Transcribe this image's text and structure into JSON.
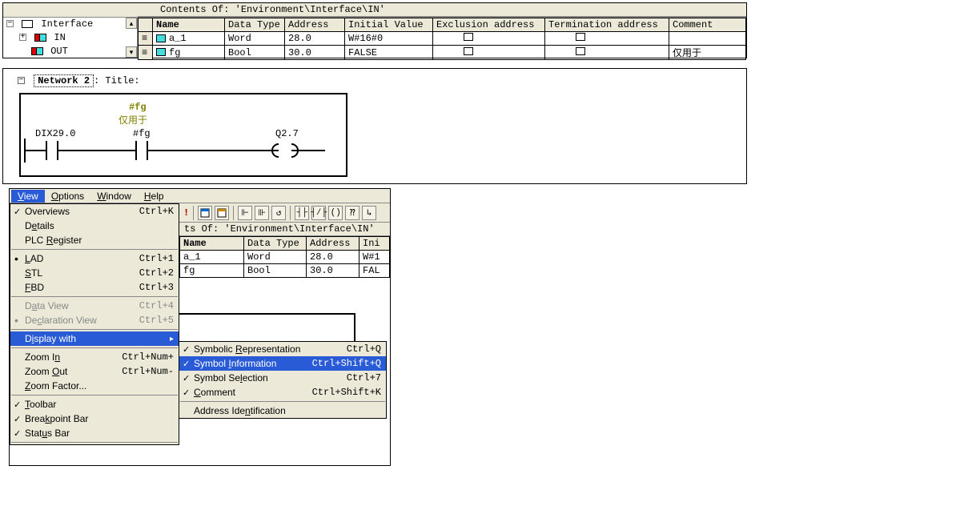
{
  "top": {
    "title": "Contents Of: 'Environment\\Interface\\IN'",
    "tree": {
      "root": "Interface",
      "child1": "IN",
      "child2": "OUT"
    },
    "columns": {
      "name": "Name",
      "dtype": "Data Type",
      "addr": "Address",
      "init": "Initial Value",
      "excl": "Exclusion address",
      "term": "Termination address",
      "comment": "Comment"
    },
    "rows": [
      {
        "name": "a_1",
        "dtype": "Word",
        "addr": "28.0",
        "init": "W#16#0",
        "comment": ""
      },
      {
        "name": "fg",
        "dtype": "Bool",
        "addr": "30.0",
        "init": "FALSE",
        "comment": "仅用于"
      }
    ]
  },
  "network": {
    "label": "Network 2",
    "suffix": ": Title:",
    "tag_top": "#fg",
    "tag_sub": "仅用于",
    "left": "DIX29.0",
    "mid": "#fg",
    "right": "Q2.7"
  },
  "menubar": {
    "view": "View",
    "options": "Options",
    "window": "Window",
    "help": "Help"
  },
  "toolbar": {
    "excl": "!",
    "sym1": "⎕",
    "sym2": "⎕",
    "cont1": "⊩",
    "cont2": "⊪",
    "cont3": "↺",
    "lad1": "┤├",
    "lad2": "┤⁄├",
    "coil": "─()",
    "box": "⁇",
    "tail": "↳"
  },
  "sec": {
    "title": "ts Of: 'Environment\\Interface\\IN'",
    "columns": {
      "name": "Name",
      "dtype": "Data Type",
      "addr": "Address",
      "init": "Ini"
    },
    "rows": [
      {
        "name": "a_1",
        "dtype": "Word",
        "addr": "28.0",
        "init": "W#1"
      },
      {
        "name": "fg",
        "dtype": "Bool",
        "addr": "30.0",
        "init": "FAL"
      }
    ]
  },
  "viewmenu": {
    "overviews": {
      "label": "Overviews",
      "scut": "Ctrl+K"
    },
    "details": {
      "label": "Details"
    },
    "plcreg": {
      "label": "PLC Register"
    },
    "lad": {
      "label": "LAD",
      "scut": "Ctrl+1"
    },
    "stl": {
      "label": "STL",
      "scut": "Ctrl+2"
    },
    "fbd": {
      "label": "FBD",
      "scut": "Ctrl+3"
    },
    "dataview": {
      "label": "Data View",
      "scut": "Ctrl+4"
    },
    "declview": {
      "label": "Declaration View",
      "scut": "Ctrl+5"
    },
    "display": {
      "label": "Display with"
    },
    "zoomin": {
      "label": "Zoom In",
      "scut": "Ctrl+Num+"
    },
    "zoomout": {
      "label": "Zoom Out",
      "scut": "Ctrl+Num-"
    },
    "zoomfact": {
      "label": "Zoom Factor..."
    },
    "toolbar": {
      "label": "Toolbar"
    },
    "bpbar": {
      "label": "Breakpoint Bar"
    },
    "statusbar": {
      "label": "Status Bar"
    }
  },
  "submenu": {
    "symrep": {
      "label": "Symbolic Representation",
      "scut": "Ctrl+Q"
    },
    "syminfo": {
      "label": "Symbol Information",
      "scut": "Ctrl+Shift+Q"
    },
    "symsel": {
      "label": "Symbol Selection",
      "scut": "Ctrl+7"
    },
    "comment": {
      "label": "Comment",
      "scut": "Ctrl+Shift+K"
    },
    "addrid": {
      "label": "Address Identification"
    }
  }
}
